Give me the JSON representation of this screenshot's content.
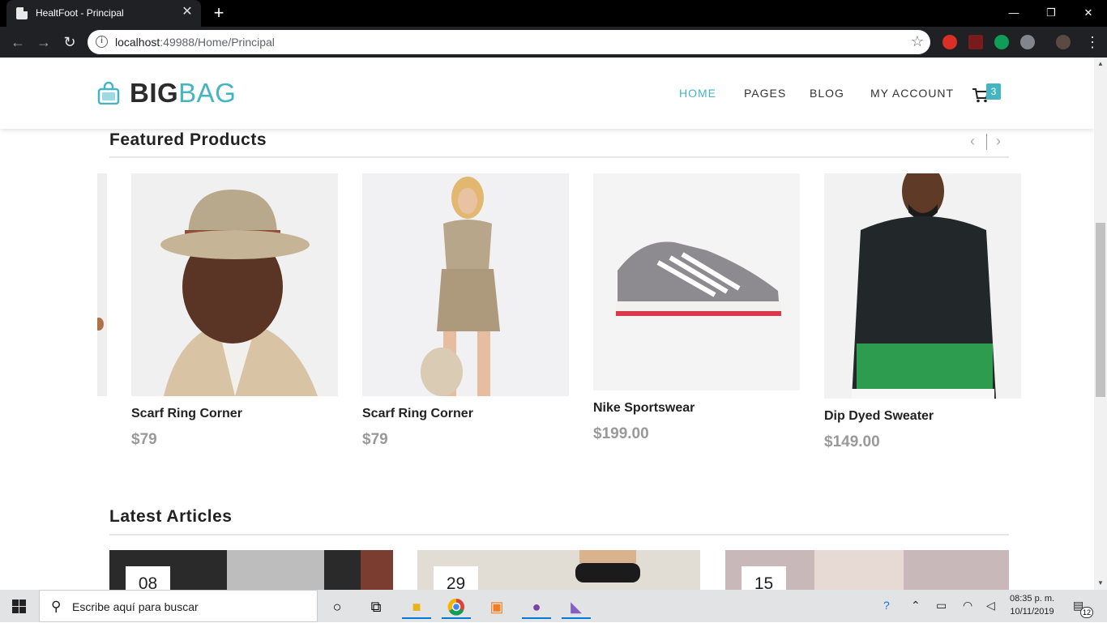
{
  "browser": {
    "tab_title": "HealtFoot - Principal",
    "tab_close": "✕",
    "new_tab": "+",
    "url_host": "localhost",
    "url_rest": ":49988/Home/Principal",
    "window_controls": {
      "minimize": "—",
      "maximize": "❐",
      "close": "✕"
    }
  },
  "header": {
    "logo_big": "BIG",
    "logo_bag": "BAG",
    "nav": [
      "HOME",
      "PAGES",
      "BLOG",
      "MY ACCOUNT"
    ],
    "cart_count": "3"
  },
  "featured": {
    "title": "Featured Products",
    "prev": "‹",
    "next": "›",
    "products": [
      {
        "name": "Scarf Ring Corner",
        "price": "$79"
      },
      {
        "name": "Scarf Ring Corner",
        "price": "$79"
      },
      {
        "name": "Nike Sportswear",
        "price": "$199.00"
      },
      {
        "name": "Dip Dyed Sweater",
        "price": "$149.00"
      }
    ]
  },
  "articles": {
    "title": "Latest Articles",
    "items": [
      {
        "day": "08"
      },
      {
        "day": "29"
      },
      {
        "day": "15"
      }
    ]
  },
  "taskbar": {
    "search_placeholder": "Escribe aquí para buscar",
    "time": "08:35 p. m.",
    "date": "10/11/2019",
    "notifications": "12"
  },
  "colors": {
    "accent": "#45b5c4",
    "text": "#222222",
    "price": "#999999"
  }
}
